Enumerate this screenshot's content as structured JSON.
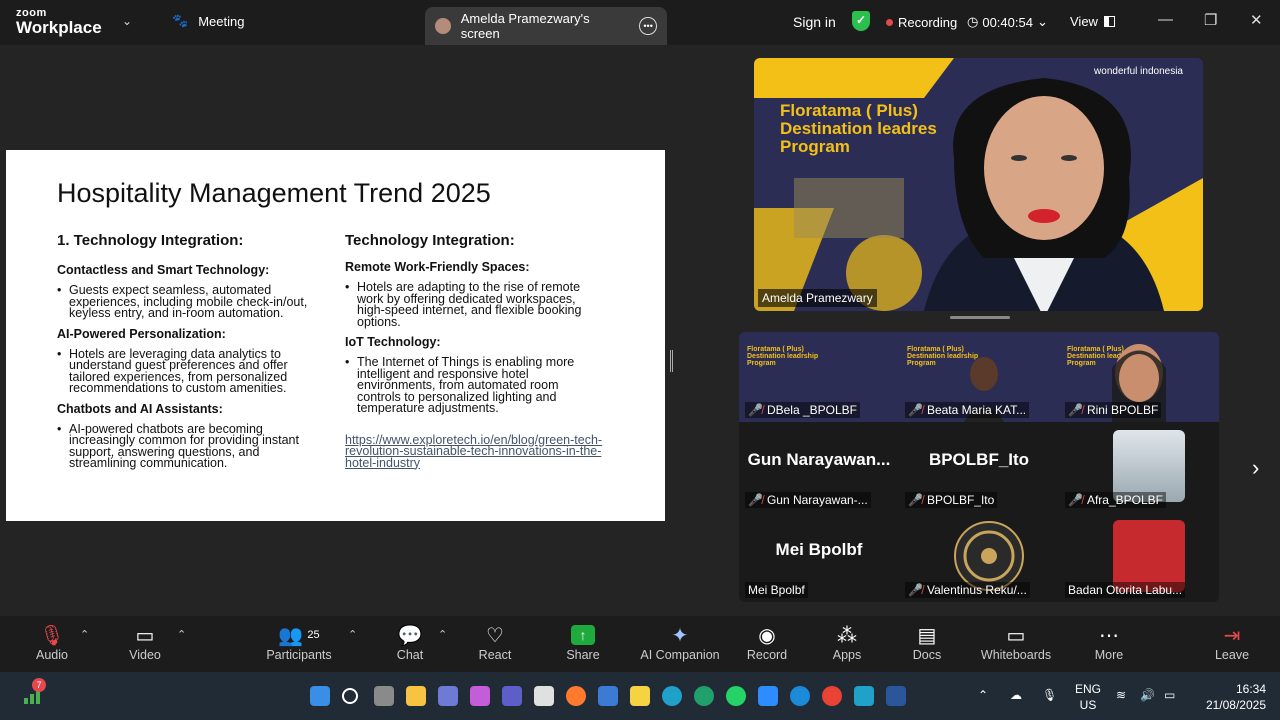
{
  "app": {
    "brand_top": "zoom",
    "brand_bottom": "Workplace",
    "meeting_label": "Meeting"
  },
  "header": {
    "screen_tab": "Amelda Pramezwary's screen",
    "sign_in": "Sign in",
    "recording": "Recording",
    "timer": "00:40:54",
    "view": "View"
  },
  "slide": {
    "title": "Hospitality Management Trend 2025",
    "left": {
      "heading": "1. Technology Integration:",
      "sections": [
        {
          "title": "Contactless and Smart Technology:",
          "bullet": "Guests expect seamless, automated experiences, including mobile check-in/out, keyless entry, and in-room automation."
        },
        {
          "title": "AI-Powered Personalization:",
          "bullet": "Hotels are leveraging data analytics to understand guest preferences and offer tailored experiences, from personalized recommendations to custom amenities."
        },
        {
          "title": "Chatbots and AI Assistants:",
          "bullet": "AI-powered chatbots are becoming increasingly common for providing instant support, answering questions, and streamlining communication."
        }
      ]
    },
    "right": {
      "heading": "Technology Integration:",
      "sections": [
        {
          "title": "Remote Work-Friendly Spaces:",
          "bullet": "Hotels are adapting to the rise of remote work by offering dedicated workspaces, high-speed internet, and flexible booking options."
        },
        {
          "title": "IoT Technology:",
          "bullet": "The Internet of Things is enabling more intelligent and responsive hotel environments, from automated room controls to personalized lighting and temperature adjustments."
        }
      ],
      "link": "https://www.exploretech.io/en/blog/green-tech-revolution-sustainable-tech-innovations-in-the-hotel-industry"
    }
  },
  "speaker": {
    "banner": "Floratama ( Plus) Destination leadres Program",
    "logo": "wonderful indonesia",
    "name": "Amelda Pramezwary"
  },
  "gallery": {
    "banner_text": "Floratama ( Plus) Destination leadrship Program",
    "tiles": [
      {
        "name": "DBela _BPOLBF",
        "big": ""
      },
      {
        "name": "Beata Maria KAT...",
        "big": ""
      },
      {
        "name": "Rini BPOLBF",
        "big": ""
      },
      {
        "name": "Gun Narayawan-...",
        "big": "Gun  Narayawan..."
      },
      {
        "name": "BPOLBF_Ito",
        "big": "BPOLBF_Ito"
      },
      {
        "name": "Afra_BPOLBF",
        "big": ""
      },
      {
        "name": "Mei Bpolbf",
        "big": "Mei Bpolbf"
      },
      {
        "name": "Valentinus Reku/...",
        "big": ""
      },
      {
        "name": "Badan Otorita Labu...",
        "big": ""
      }
    ]
  },
  "toolbar": {
    "audio": "Audio",
    "video": "Video",
    "participants": "Participants",
    "participants_count": "25",
    "chat": "Chat",
    "react": "React",
    "share": "Share",
    "ai": "AI Companion",
    "record": "Record",
    "apps": "Apps",
    "docs": "Docs",
    "whiteboards": "Whiteboards",
    "more": "More",
    "leave": "Leave"
  },
  "taskbar": {
    "badge": "7",
    "lang1": "ENG",
    "lang2": "US",
    "time": "16:34",
    "date": "21/08/2025"
  }
}
